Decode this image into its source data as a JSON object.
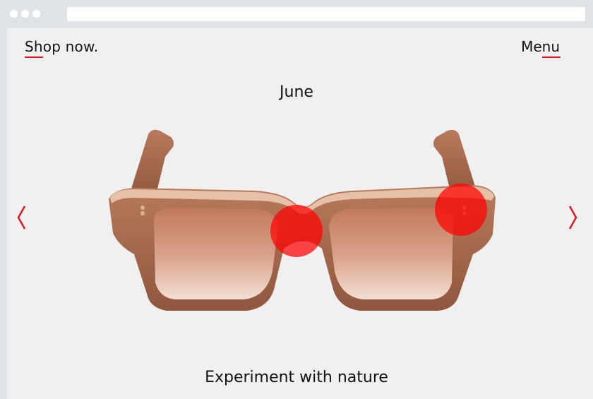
{
  "nav": {
    "shop_label": "Shop now.",
    "menu_label": "Menu"
  },
  "product": {
    "name": "June",
    "tagline": "Experiment with nature"
  },
  "carousel": {
    "prev_icon": "chevron-left-icon",
    "next_icon": "chevron-right-icon"
  },
  "hotspots": [
    {
      "name": "bridge-hotspot"
    },
    {
      "name": "hinge-hotspot"
    }
  ],
  "colors": {
    "accent": "#e0121f",
    "background": "#f1f0f1",
    "frame_wood": "#a8674b",
    "lens": "#c98a73"
  }
}
